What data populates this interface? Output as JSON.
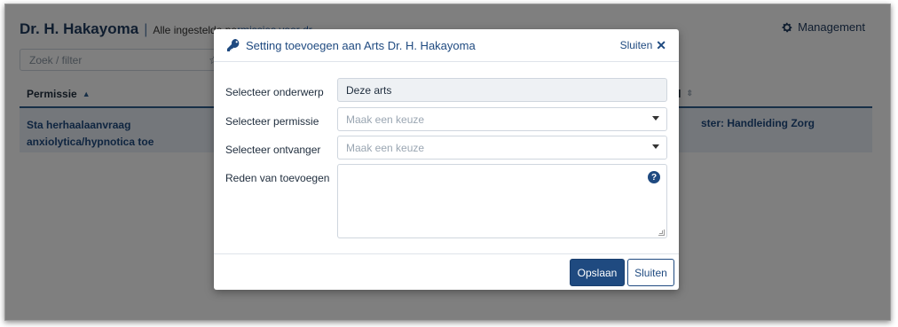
{
  "page": {
    "title": "Dr. H. Hakayoma",
    "separator": "|",
    "subtitle_prefix": "Alle ingestelde pe",
    "subtitle_link": "rmissies voor dr",
    "management_label": "Management",
    "filter_placeholder": "Zoek / filter",
    "table": {
      "col_permission": "Permissie",
      "col_right": "el",
      "row": {
        "permission": "Sta herhaalaanvraag anxiolytica/hypnotica toe",
        "right_cell": "ster: Handleiding Zorg"
      }
    }
  },
  "modal": {
    "title": "Setting toevoegen aan Arts Dr. H. Hakayoma",
    "close_label": "Sluiten",
    "fields": {
      "subject_label": "Selecteer onderwerp",
      "subject_value": "Deze arts",
      "permission_label": "Selecteer permissie",
      "permission_placeholder": "Maak een keuze",
      "recipient_label": "Selecteer ontvanger",
      "recipient_placeholder": "Maak een keuze",
      "reason_label": "Reden van toevoegen"
    },
    "save_label": "Opslaan",
    "cancel_label": "Sluiten"
  },
  "icons": {
    "key": "key-icon",
    "gear": "gear-icon",
    "close": "close-icon",
    "help": "help-icon",
    "star": "star-icon",
    "sort": "sort-icon"
  },
  "colors": {
    "primary": "#1f4a80",
    "table_row_bg": "#e8eef6",
    "overlay": "rgba(0,0,0,0.5)"
  }
}
